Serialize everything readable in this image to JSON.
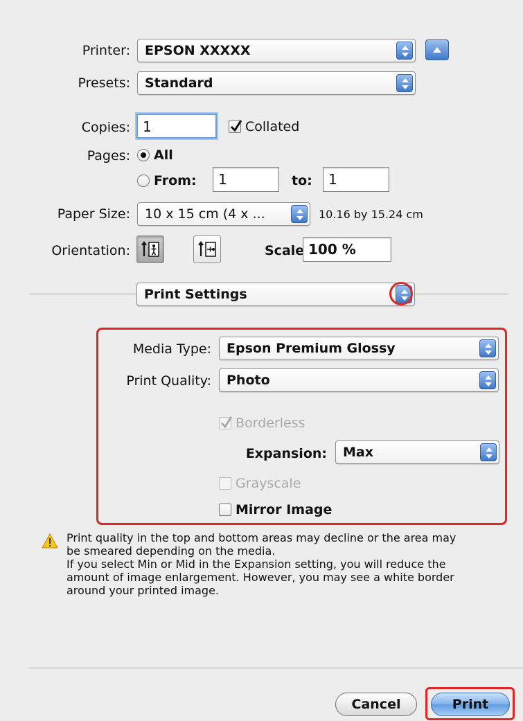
{
  "printer": {
    "label": "Printer:",
    "value": "EPSON XXXXX"
  },
  "presets": {
    "label": "Presets:",
    "value": "Standard"
  },
  "copies": {
    "label": "Copies:",
    "value": "1",
    "collated_label": "Collated",
    "collated_checked": true
  },
  "pages": {
    "label": "Pages:",
    "all_label": "All",
    "from_label": "From:",
    "from_value": "1",
    "to_label": "to:",
    "to_value": "1",
    "selected": "All"
  },
  "paper_size": {
    "label": "Paper Size:",
    "value": "10 x 15 cm (4 x ...",
    "dimensions": "10.16 by 15.24 cm"
  },
  "orientation": {
    "label": "Orientation:",
    "selected": "portrait"
  },
  "scale": {
    "label": "Scale:",
    "value": "100 %"
  },
  "panel": {
    "value": "Print Settings"
  },
  "settings": {
    "media_type_label": "Media Type:",
    "media_type_value": "Epson Premium Glossy",
    "print_quality_label": "Print Quality:",
    "print_quality_value": "Photo",
    "borderless_label": "Borderless",
    "borderless_checked": true,
    "expansion_label": "Expansion:",
    "expansion_value": "Max",
    "grayscale_label": "Grayscale",
    "grayscale_checked": false,
    "mirror_label": "Mirror Image",
    "mirror_checked": false
  },
  "warning": {
    "icon": "warning-icon",
    "line1": "Print quality in the top and bottom areas may decline or the area may",
    "line2": "be smeared depending on the media.",
    "line3": "If you select Min or Mid in the Expansion setting, you will reduce the",
    "line4": "amount of image enlargement. However, you may see a white border",
    "line5": "around your printed image."
  },
  "buttons": {
    "cancel": "Cancel",
    "print": "Print"
  },
  "colors": {
    "highlight": "#e02525",
    "accent": "#3f79c9",
    "background": "#ededed"
  }
}
